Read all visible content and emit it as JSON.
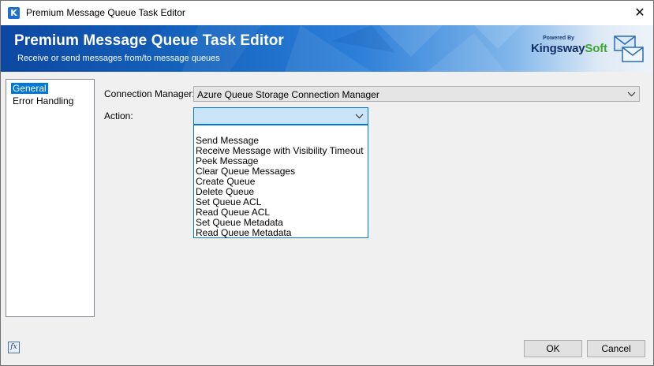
{
  "window": {
    "title": "Premium Message Queue Task Editor",
    "app_icon_letter": "K",
    "close_glyph": "✕"
  },
  "banner": {
    "title": "Premium Message Queue Task Editor",
    "subtitle": "Receive or send messages from/to message queues",
    "logo_small": "Powered By",
    "logo_main": "Kingsway",
    "logo_accent": "Soft",
    "icon": "mail-stack-icon"
  },
  "nav": {
    "items": [
      {
        "label": "General",
        "selected": true
      },
      {
        "label": "Error Handling",
        "selected": false
      }
    ]
  },
  "form": {
    "connection_manager_label": "Connection Manager:",
    "connection_manager_value": "Azure Queue Storage Connection Manager",
    "action_label": "Action:",
    "action_value": "",
    "action_options": [
      "Send Message",
      "Receive Message with Visibility Timeout",
      "Peek Message",
      "Clear Queue Messages",
      "Create Queue",
      "Delete Queue",
      "Set Queue ACL",
      "Read Queue ACL",
      "Set Queue Metadata",
      "Read Queue Metadata"
    ]
  },
  "footer": {
    "fx_label": "fx",
    "ok_label": "OK",
    "cancel_label": "Cancel"
  },
  "colors": {
    "selection": "#0078d7",
    "banner_dark": "#0d47a1",
    "dropdown_hover": "#cce4f7"
  }
}
